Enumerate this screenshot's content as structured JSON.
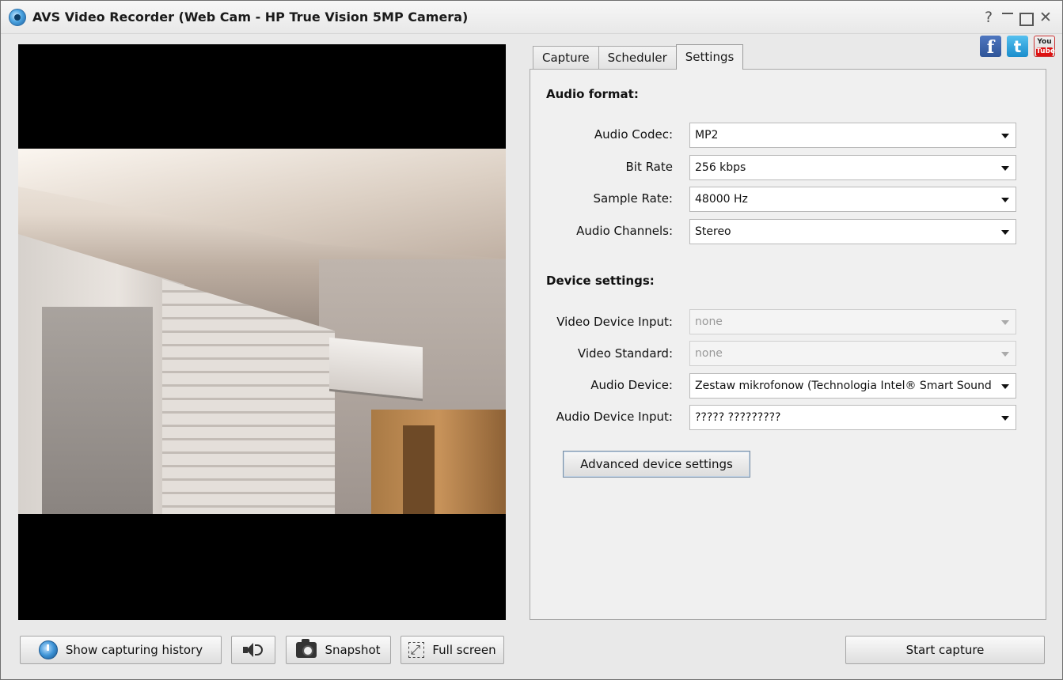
{
  "window": {
    "title": "AVS Video Recorder (Web Cam - HP True Vision 5MP Camera)",
    "controls": {
      "help": "?"
    }
  },
  "tabs": [
    {
      "label": "Capture",
      "active": false
    },
    {
      "label": "Scheduler",
      "active": false
    },
    {
      "label": "Settings",
      "active": true
    }
  ],
  "social": {
    "facebook": "f",
    "twitter": "t",
    "youtube_top": "You",
    "youtube_bottom": "Tube"
  },
  "audio_format": {
    "title": "Audio format:",
    "codec": {
      "label": "Audio Codec:",
      "value": "MP2"
    },
    "bit_rate": {
      "label": "Bit Rate",
      "value": "256 kbps"
    },
    "sample_rate": {
      "label": "Sample Rate:",
      "value": "48000 Hz"
    },
    "channels": {
      "label": "Audio Channels:",
      "value": "Stereo"
    }
  },
  "device_settings": {
    "title": "Device settings:",
    "video_input": {
      "label": "Video Device Input:",
      "value": "none"
    },
    "video_standard": {
      "label": "Video Standard:",
      "value": "none"
    },
    "audio_device": {
      "label": "Audio Device:",
      "value": "Zestaw mikrofonow (Technologia Intel® Smart Sound"
    },
    "audio_input": {
      "label": "Audio Device Input:",
      "value": "????? ?????????"
    },
    "advanced_button": "Advanced device settings"
  },
  "bottom": {
    "history_label": "Show capturing history",
    "snapshot_label": "Snapshot",
    "fullscreen_label": "Full screen",
    "start_label": "Start capture"
  }
}
